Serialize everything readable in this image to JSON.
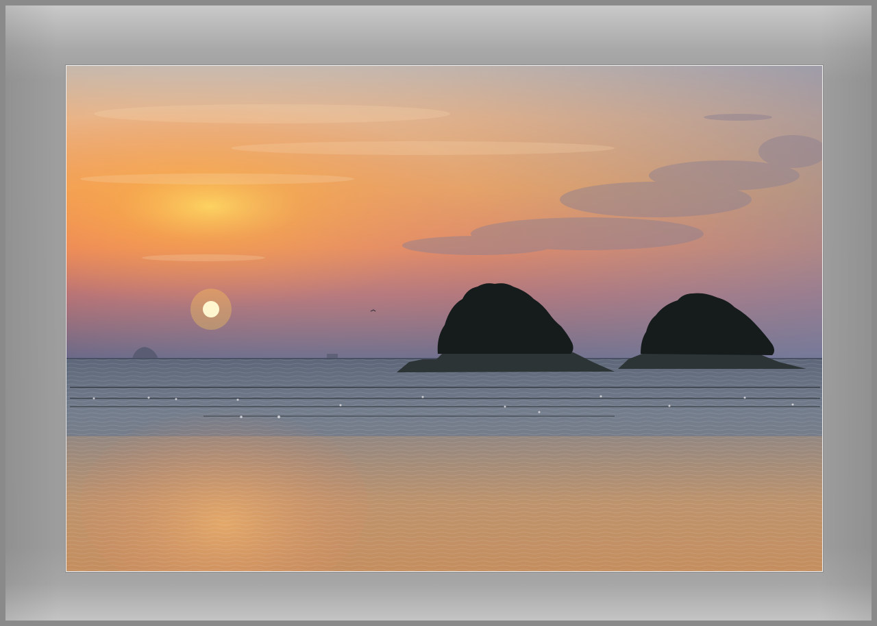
{
  "scene": {
    "subject": "sunset-over-sea-with-two-islands",
    "colors": {
      "frame": "#9e9e9e",
      "sky_top": "#c9b7a4",
      "sky_mid": "#f3a05a",
      "sky_horizon": "#6c6988",
      "sun": "#fff6d0",
      "sea": "#7e8793",
      "island": "#1a2021"
    }
  }
}
